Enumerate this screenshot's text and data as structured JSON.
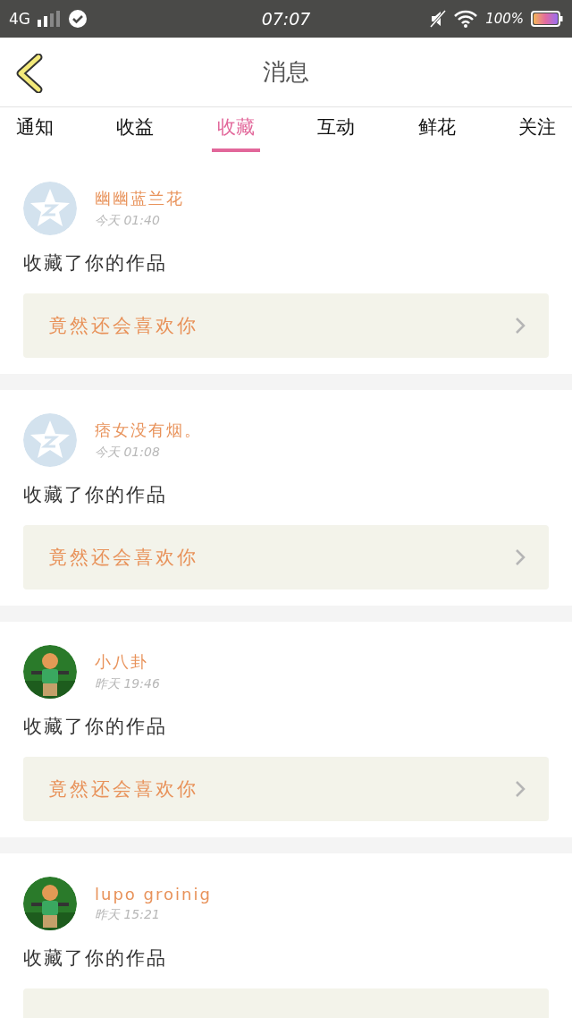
{
  "status_bar": {
    "network": "4G",
    "time": "07:07",
    "battery": "100%"
  },
  "header": {
    "title": "消息"
  },
  "tabs": [
    {
      "label": "通知",
      "selected": false
    },
    {
      "label": "收益",
      "selected": false
    },
    {
      "label": "收藏",
      "selected": true
    },
    {
      "label": "互动",
      "selected": false
    },
    {
      "label": "鲜花",
      "selected": false
    },
    {
      "label": "关注",
      "selected": false
    }
  ],
  "messages": [
    {
      "avatar": {
        "kind": "default"
      },
      "name": "幽幽蓝兰花",
      "time": "今天 01:40",
      "action": "收藏了你的作品",
      "work": "竟然还会喜欢你"
    },
    {
      "avatar": {
        "kind": "default"
      },
      "name": "痞女没有烟。",
      "time": "今天 01:08",
      "action": "收藏了你的作品",
      "work": "竟然还会喜欢你"
    },
    {
      "name": "小八卦",
      "time": "昨天 19:46",
      "action": "收藏了你的作品",
      "work": "竟然还会喜欢你"
    },
    {
      "name": "lupo groinig",
      "time": "昨天 15:21",
      "action": "收藏了你的作品"
    }
  ]
}
